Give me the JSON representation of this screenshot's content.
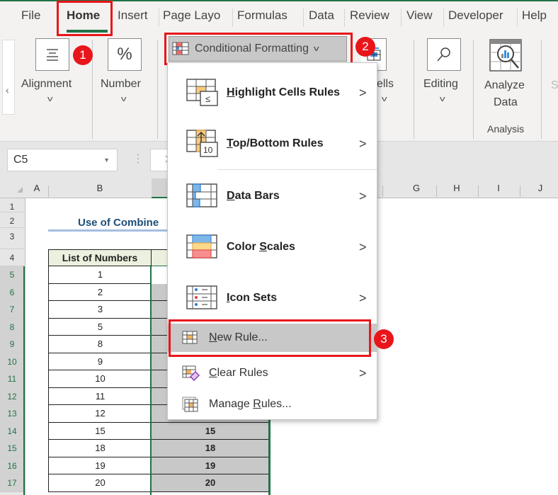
{
  "ribbon": {
    "tabs": [
      {
        "label": "File",
        "active": false
      },
      {
        "label": "Home",
        "active": true
      },
      {
        "label": "Insert",
        "active": false
      },
      {
        "label": "Page Layo",
        "active": false
      },
      {
        "label": "Formulas",
        "active": false
      },
      {
        "label": "Data",
        "active": false
      },
      {
        "label": "Review",
        "active": false
      },
      {
        "label": "View",
        "active": false
      },
      {
        "label": "Developer",
        "active": false
      },
      {
        "label": "Help",
        "active": false
      }
    ],
    "groups": {
      "alignment": "Alignment",
      "number": "Number",
      "cells": "ells",
      "editing": "Editing",
      "analyze_line1": "Analyze",
      "analyze_line2": "Data",
      "analysis_group": "Analysis",
      "cut_off": "S"
    },
    "scroll_left": "‹",
    "conditional_formatting_label": "Conditional Formatting",
    "accent_color": "#217346"
  },
  "formula_bar": {
    "name_box": "C5"
  },
  "grid": {
    "columns": [
      "A",
      "B",
      "G",
      "H",
      "I",
      "J"
    ],
    "rows": [
      "1",
      "2",
      "3",
      "4",
      "5",
      "6",
      "7",
      "8",
      "9",
      "10",
      "11",
      "12",
      "13",
      "14",
      "15",
      "16",
      "17"
    ],
    "title": "Use of Combine",
    "table_header": "List of Numbers",
    "list_values": [
      "1",
      "2",
      "3",
      "5",
      "8",
      "9",
      "10",
      "11",
      "12",
      "15",
      "18",
      "19",
      "20"
    ],
    "col_c_values": [
      "",
      "",
      "",
      "",
      "",
      "",
      "",
      "",
      "",
      "15",
      "18",
      "19",
      "20"
    ]
  },
  "menu": {
    "items": [
      {
        "label_pre": "",
        "label_u": "H",
        "label_post": "ighlight Cells Rules",
        "submenu": true,
        "icon": "highlight-cells-rules-icon"
      },
      {
        "label_pre": "",
        "label_u": "T",
        "label_post": "op/Bottom Rules",
        "submenu": true,
        "icon": "top-bottom-rules-icon"
      },
      {
        "label_pre": "",
        "label_u": "D",
        "label_post": "ata Bars",
        "submenu": true,
        "icon": "data-bars-icon"
      },
      {
        "label_pre": "Color ",
        "label_u": "S",
        "label_post": "cales",
        "submenu": true,
        "icon": "color-scales-icon"
      },
      {
        "label_pre": "",
        "label_u": "I",
        "label_post": "con Sets",
        "submenu": true,
        "icon": "icon-sets-icon"
      },
      {
        "label_pre": "",
        "label_u": "N",
        "label_post": "ew Rule...",
        "submenu": false,
        "icon": "new-rule-icon"
      },
      {
        "label_pre": "",
        "label_u": "C",
        "label_post": "lear Rules",
        "submenu": true,
        "icon": "clear-rules-icon"
      },
      {
        "label_pre": "Manage ",
        "label_u": "R",
        "label_post": "ules...",
        "submenu": false,
        "icon": "manage-rules-icon"
      }
    ],
    "submenu_arrow": ">"
  },
  "annotations": {
    "step1": "1",
    "step2": "2",
    "step3": "3",
    "highlight_color": "#e8161b"
  }
}
